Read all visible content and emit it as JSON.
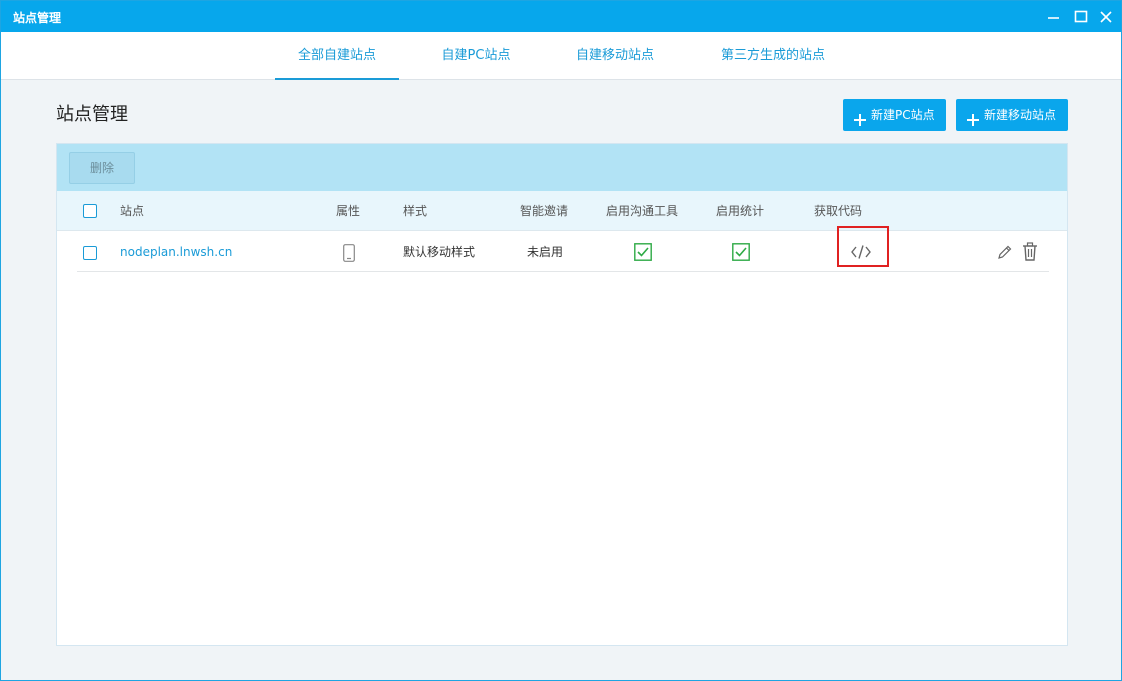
{
  "window": {
    "title": "站点管理",
    "controls": {
      "minimize": "minimize-icon",
      "maximize": "maximize-icon",
      "close": "close-icon"
    }
  },
  "tabs": [
    {
      "label": "全部自建站点",
      "active": true
    },
    {
      "label": "自建PC站点",
      "active": false
    },
    {
      "label": "自建移动站点",
      "active": false
    },
    {
      "label": "第三方生成的站点",
      "active": false
    }
  ],
  "page": {
    "title": "站点管理",
    "new_pc_label": "新建PC站点",
    "new_mobile_label": "新建移动站点"
  },
  "toolbar": {
    "delete_label": "删除"
  },
  "table": {
    "columns": [
      "站点",
      "属性",
      "样式",
      "智能邀请",
      "启用沟通工具",
      "启用统计",
      "获取代码"
    ],
    "rows": [
      {
        "site": "nodeplan.lnwsh.cn",
        "attribute_icon": "mobile-phone-icon",
        "style": "默认移动样式",
        "smart_invite": "未启用",
        "chat_tool_enabled": true,
        "stats_enabled": true,
        "code_icon": "code-icon"
      }
    ]
  },
  "colors": {
    "accent": "#07a7ec",
    "link": "#1a9bd7",
    "check": "#2eaa45",
    "highlight": "#e02121"
  }
}
